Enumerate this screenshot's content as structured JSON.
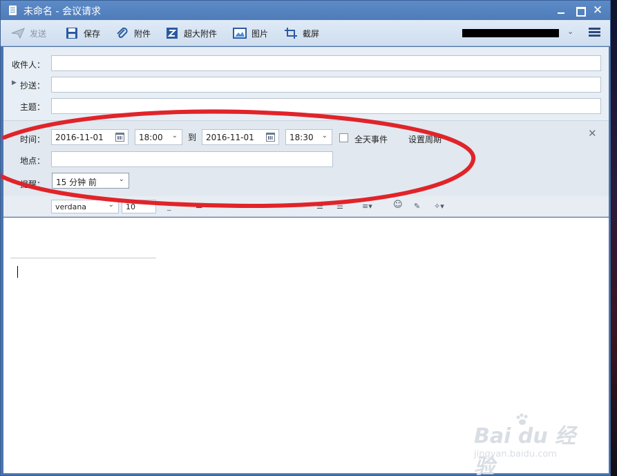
{
  "window": {
    "title": "未命名 - 会议请求"
  },
  "toolbar": {
    "send": "发送",
    "save": "保存",
    "attach": "附件",
    "large_attach": "超大附件",
    "picture": "图片",
    "screenshot": "截屏"
  },
  "form": {
    "to_label": "收件人：",
    "cc_label": "抄送：",
    "subject_label": "主题：",
    "to_value": "",
    "cc_value": "",
    "subject_value": ""
  },
  "meeting": {
    "time_label": "时间：",
    "start_date": "2016-11-01",
    "start_time": "18:00",
    "to_word": "到",
    "end_date": "2016-11-01",
    "end_time": "18:30",
    "all_day_label": "全天事件",
    "all_day_checked": false,
    "recurrence_label": "设置周期",
    "location_label": "地点：",
    "location_value": "",
    "reminder_label": "提醒：",
    "reminder_value": "15 分钟 前"
  },
  "format": {
    "font_family": "verdana",
    "font_size": "10"
  },
  "annotation": {
    "color": "#e0242a"
  },
  "watermark": {
    "brand": "Bai du 经验",
    "url": "jingyan.baidu.com"
  }
}
